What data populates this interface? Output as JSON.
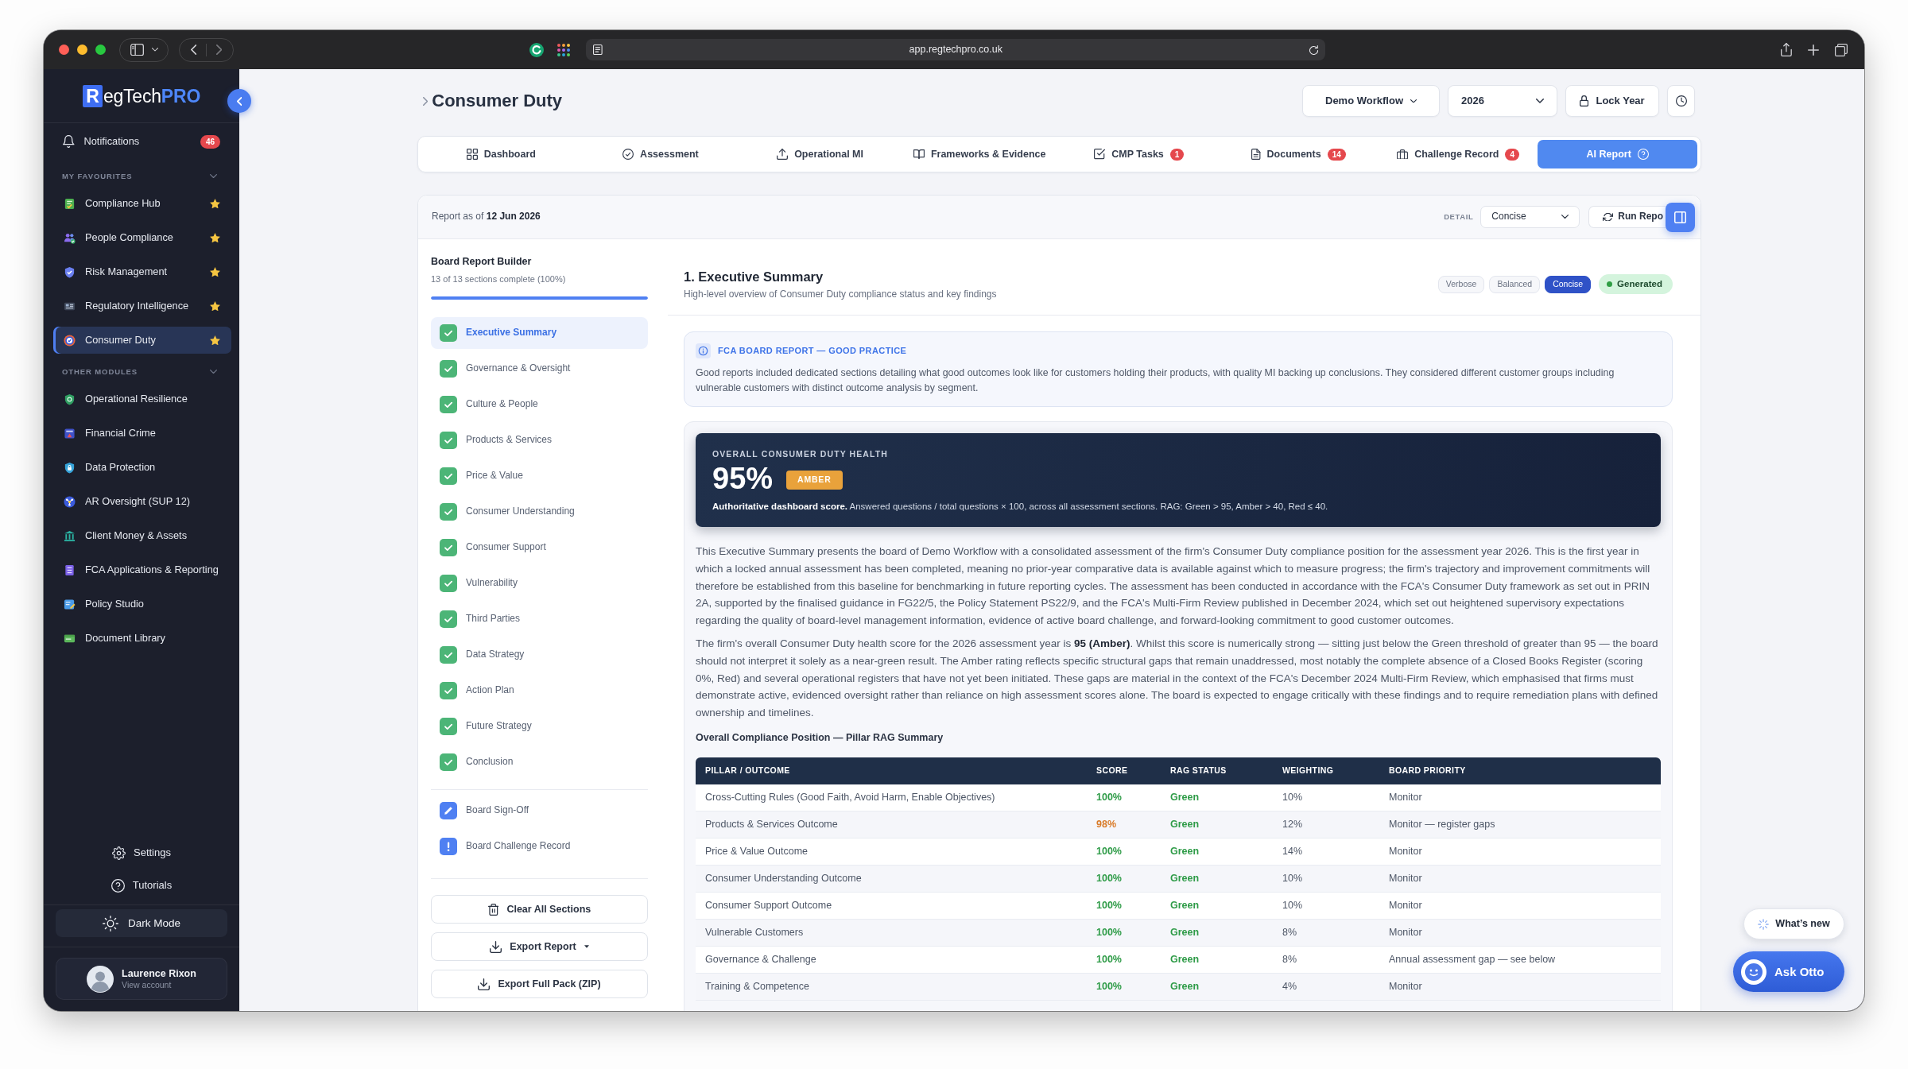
{
  "browser": {
    "url": "app.regtechpro.co.uk"
  },
  "sidebar": {
    "logo": [
      {
        "text": "R",
        "kind": "tile"
      },
      {
        "text": "egTech",
        "kind": "plain"
      },
      {
        "text": "PRO",
        "kind": "accent"
      }
    ],
    "notifications": {
      "label": "Notifications",
      "count": "46"
    },
    "groups": [
      {
        "title": "MY FAVOURITES",
        "expanded": true,
        "items": [
          {
            "label": "Compliance Hub",
            "starred": true,
            "selected": false
          },
          {
            "label": "People Compliance",
            "starred": true,
            "selected": false
          },
          {
            "label": "Risk Management",
            "starred": true,
            "selected": false
          },
          {
            "label": "Regulatory Intelligence",
            "starred": true,
            "selected": false
          },
          {
            "label": "Consumer Duty",
            "starred": true,
            "selected": true
          }
        ]
      },
      {
        "title": "OTHER MODULES",
        "expanded": true,
        "items": [
          {
            "label": "Operational Resilience",
            "starred": false,
            "selected": false
          },
          {
            "label": "Financial Crime",
            "starred": false,
            "selected": false
          },
          {
            "label": "Data Protection",
            "starred": false,
            "selected": false
          },
          {
            "label": "AR Oversight (SUP 12)",
            "starred": false,
            "selected": false
          },
          {
            "label": "Client Money & Assets",
            "starred": false,
            "selected": false
          },
          {
            "label": "FCA Applications & Reporting",
            "starred": false,
            "selected": false
          },
          {
            "label": "Policy Studio",
            "starred": false,
            "selected": false
          },
          {
            "label": "Document Library",
            "starred": false,
            "selected": false
          }
        ]
      }
    ],
    "footer_links": [
      {
        "label": "Settings"
      },
      {
        "label": "Tutorials"
      }
    ],
    "theme_toggle": {
      "label": "Dark Mode"
    },
    "user": {
      "name": "Laurence Rixon",
      "subtitle": "View account"
    }
  },
  "header": {
    "title": "Consumer Duty",
    "workflow": "Demo Workflow",
    "year": "2026",
    "lock": "Lock Year"
  },
  "tabs": [
    {
      "label": "Dashboard",
      "selected": false
    },
    {
      "label": "Assessment",
      "selected": false
    },
    {
      "label": "Operational MI",
      "selected": false
    },
    {
      "label": "Frameworks & Evidence",
      "selected": false
    },
    {
      "label": "CMP Tasks",
      "badge": "1",
      "selected": false
    },
    {
      "label": "Documents",
      "badge": "14",
      "selected": false
    },
    {
      "label": "Challenge Record",
      "badge": "4",
      "selected": false
    },
    {
      "label": "AI Report",
      "selected": true
    }
  ],
  "report": {
    "as_of": "Report as of **12 Jun 2026**",
    "detail_label": "DETAIL",
    "detail_value": "Concise",
    "run_button": "Run Repo"
  },
  "builder": {
    "title": "Board Report Builder",
    "progress_text": "13 of 13 sections complete (100%)",
    "progress": {
      "level": 1
    },
    "sections": [
      {
        "label": "Executive Summary",
        "complete": true,
        "selected": true
      },
      {
        "label": "Governance & Oversight",
        "complete": true,
        "selected": false
      },
      {
        "label": "Culture & People",
        "complete": true,
        "selected": false
      },
      {
        "label": "Products & Services",
        "complete": true,
        "selected": false
      },
      {
        "label": "Price & Value",
        "complete": true,
        "selected": false
      },
      {
        "label": "Consumer Understanding",
        "complete": true,
        "selected": false
      },
      {
        "label": "Consumer Support",
        "complete": true,
        "selected": false
      },
      {
        "label": "Vulnerability",
        "complete": true,
        "selected": false
      },
      {
        "label": "Third Parties",
        "complete": true,
        "selected": false
      },
      {
        "label": "Data Strategy",
        "complete": true,
        "selected": false
      },
      {
        "label": "Action Plan",
        "complete": true,
        "selected": false
      },
      {
        "label": "Future Strategy",
        "complete": true,
        "selected": false
      },
      {
        "label": "Conclusion",
        "complete": true,
        "selected": false
      }
    ],
    "extras": [
      {
        "label": "Board Sign-Off"
      },
      {
        "label": "Board Challenge Record"
      }
    ],
    "actions": [
      {
        "label": "Clear All Sections",
        "dropdown": false
      },
      {
        "label": "Export Report",
        "dropdown": true
      },
      {
        "label": "Export Full Pack (ZIP)",
        "dropdown": false
      }
    ]
  },
  "section": {
    "title": "1. Executive Summary",
    "subtitle": "High-level overview of Consumer Duty compliance status and key findings",
    "modes": [
      {
        "label": "Verbose",
        "selected": false
      },
      {
        "label": "Balanced",
        "selected": false
      },
      {
        "label": "Concise",
        "selected": true
      }
    ],
    "status": {
      "label": "Generated"
    },
    "callout": {
      "title": "FCA BOARD REPORT — GOOD PRACTICE",
      "body": "Good reports included dedicated sections detailing what good outcomes look like for customers holding their products, with quality MI backing up conclusions. They considered different customer groups including vulnerable customers with distinct outcome analysis by segment."
    },
    "health": {
      "label": "OVERALL CONSUMER DUTY HEALTH",
      "score": "95%",
      "rag": "AMBER",
      "description": "**Authoritative dashboard score.** Answered questions / total questions × 100, across all assessment sections. RAG: Green > 95, Amber > 40, Red ≤ 40."
    },
    "paragraphs": [
      "This Executive Summary presents the board of Demo Workflow with a consolidated assessment of the firm's Consumer Duty compliance position for the assessment year 2026. This is the first year in which a locked annual assessment has been completed, meaning no prior-year comparative data is available against which to measure progress; the firm's trajectory and improvement commitments will therefore be established from this baseline for benchmarking in future reporting cycles. The assessment has been conducted in accordance with the FCA's Consumer Duty framework as set out in PRIN 2A, supported by the finalised guidance in FG22/5, the Policy Statement PS22/9, and the FCA's Multi-Firm Review published in December 2024, which set out heightened supervisory expectations regarding the quality of board-level management information, evidence of active board challenge, and forward-looking commitment to good customer outcomes.",
      "The firm's overall Consumer Duty health score for the 2026 assessment year is **95 (Amber)**. Whilst this score is numerically strong — sitting just below the Green threshold of greater than 95 — the board should not interpret it solely as a near-green result. The Amber rating reflects specific structural gaps that remain unaddressed, most notably the complete absence of a Closed Books Register (scoring 0%, Red) and several operational registers that have not yet been initiated. These gaps are material in the context of the FCA's December 2024 Multi-Firm Review, which emphasised that firms must demonstrate active, evidenced oversight rather than reliance on high assessment scores alone. The board is expected to engage critically with these findings and to require remediation plans with defined ownership and timelines."
    ],
    "table_title": "Overall Compliance Position — Pillar RAG Summary",
    "table": {
      "columns": [
        "PILLAR / OUTCOME",
        "SCORE",
        "RAG STATUS",
        "WEIGHTING",
        "BOARD PRIORITY"
      ],
      "rows": [
        {
          "pillar": "Cross-Cutting Rules (Good Faith, Avoid Harm, Enable Objectives)",
          "score": {
            "text": "100%",
            "color": "#2e9b47"
          },
          "rag": {
            "text": "Green",
            "color": "#2e9b47"
          },
          "weighting": "10%",
          "priority": "Monitor"
        },
        {
          "pillar": "Products & Services Outcome",
          "score": {
            "text": "98%",
            "color": "#d97b29"
          },
          "rag": {
            "text": "Green",
            "color": "#2e9b47"
          },
          "weighting": "12%",
          "priority": "Monitor — register gaps"
        },
        {
          "pillar": "Price & Value Outcome",
          "score": {
            "text": "100%",
            "color": "#2e9b47"
          },
          "rag": {
            "text": "Green",
            "color": "#2e9b47"
          },
          "weighting": "14%",
          "priority": "Monitor"
        },
        {
          "pillar": "Consumer Understanding Outcome",
          "score": {
            "text": "100%",
            "color": "#2e9b47"
          },
          "rag": {
            "text": "Green",
            "color": "#2e9b47"
          },
          "weighting": "10%",
          "priority": "Monitor"
        },
        {
          "pillar": "Consumer Support Outcome",
          "score": {
            "text": "100%",
            "color": "#2e9b47"
          },
          "rag": {
            "text": "Green",
            "color": "#2e9b47"
          },
          "weighting": "10%",
          "priority": "Monitor"
        },
        {
          "pillar": "Vulnerable Customers",
          "score": {
            "text": "100%",
            "color": "#2e9b47"
          },
          "rag": {
            "text": "Green",
            "color": "#2e9b47"
          },
          "weighting": "8%",
          "priority": "Monitor"
        },
        {
          "pillar": "Governance & Challenge",
          "score": {
            "text": "100%",
            "color": "#2e9b47"
          },
          "rag": {
            "text": "Green",
            "color": "#2e9b47"
          },
          "weighting": "8%",
          "priority": "Annual assessment gap — see below"
        },
        {
          "pillar": "Training & Competence",
          "score": {
            "text": "100%",
            "color": "#2e9b47"
          },
          "rag": {
            "text": "Green",
            "color": "#2e9b47"
          },
          "weighting": "4%",
          "priority": "Monitor"
        }
      ]
    }
  },
  "floating": {
    "whats_new": "What’s new",
    "assistant": "Ask Otto"
  }
}
